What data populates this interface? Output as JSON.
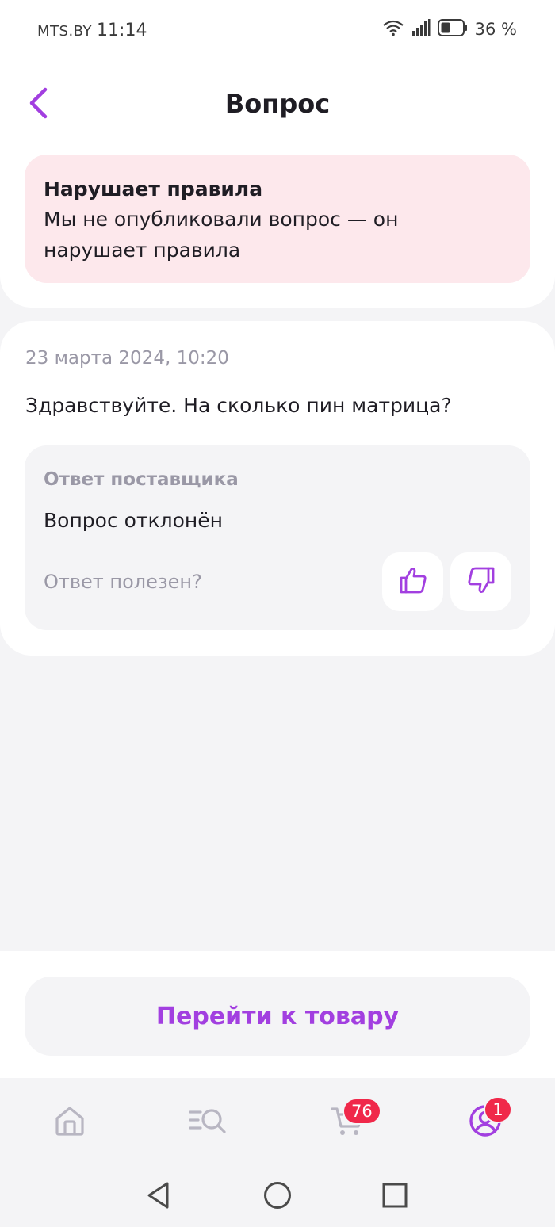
{
  "status_bar": {
    "carrier": "MTS.BY",
    "time": "11:14",
    "battery": "36 %"
  },
  "header": {
    "title": "Вопрос"
  },
  "alert": {
    "title": "Нарушает правила",
    "text_line1": "Мы не опубликовали вопрос — он",
    "text_line2": "нарушает правила"
  },
  "question": {
    "date": "23 марта 2024, 10:20",
    "text": "Здравствуйте. На сколько пин матрица?"
  },
  "answer": {
    "label": "Ответ поставщика",
    "text": "Вопрос отклонён",
    "helpful_prompt": "Ответ полезен?"
  },
  "action": {
    "goto_label": "Перейти к товару"
  },
  "bottom_nav": {
    "cart_count": "76",
    "profile_count": "1"
  },
  "colors": {
    "accent": "#a23fe0",
    "alert_bg": "#fde8ec",
    "badge": "#f0284a",
    "muted_text": "#9a98a6",
    "nav_icon": "#b8b6c2"
  },
  "icons": {
    "back": "chevron-left-icon",
    "thumbs_up": "thumbs-up-icon",
    "thumbs_down": "thumbs-down-icon",
    "home": "home-icon",
    "catalog": "catalog-search-icon",
    "cart": "cart-icon",
    "profile": "profile-icon"
  }
}
